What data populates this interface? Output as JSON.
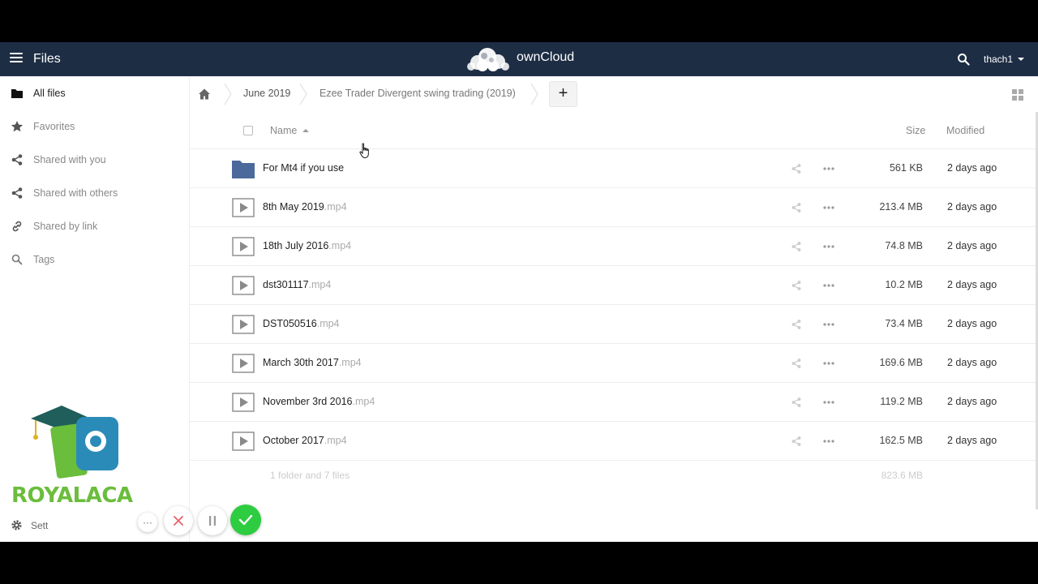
{
  "header": {
    "app_title": "Files",
    "logo_text": "ownCloud",
    "user": "thach1"
  },
  "sidebar": {
    "items": [
      {
        "label": "All files",
        "icon": "folder-icon",
        "active": true
      },
      {
        "label": "Favorites",
        "icon": "star-icon"
      },
      {
        "label": "Shared with you",
        "icon": "share-icon"
      },
      {
        "label": "Shared with others",
        "icon": "share-icon"
      },
      {
        "label": "Shared by link",
        "icon": "link-icon"
      },
      {
        "label": "Tags",
        "icon": "tag-search-icon"
      }
    ],
    "settings_label": "Sett",
    "watermark_text": "ROYALACA"
  },
  "breadcrumb": {
    "items": [
      "June 2019",
      "Ezee Trader Divergent swing trading (2019)"
    ],
    "new_label": "+"
  },
  "table": {
    "headers": {
      "name": "Name",
      "size": "Size",
      "modified": "Modified"
    },
    "rows": [
      {
        "name": "For Mt4 if you use",
        "ext": "",
        "type": "folder",
        "size": "561 KB",
        "modified": "2 days ago"
      },
      {
        "name": "8th May 2019",
        "ext": ".mp4",
        "type": "video",
        "size": "213.4 MB",
        "modified": "2 days ago"
      },
      {
        "name": "18th July 2016",
        "ext": ".mp4",
        "type": "video",
        "size": "74.8 MB",
        "modified": "2 days ago"
      },
      {
        "name": "dst301117",
        "ext": ".mp4",
        "type": "video",
        "size": "10.2 MB",
        "modified": "2 days ago"
      },
      {
        "name": "DST050516",
        "ext": ".mp4",
        "type": "video",
        "size": "73.4 MB",
        "modified": "2 days ago"
      },
      {
        "name": "March 30th 2017",
        "ext": ".mp4",
        "type": "video",
        "size": "169.6 MB",
        "modified": "2 days ago"
      },
      {
        "name": "November 3rd 2016",
        "ext": ".mp4",
        "type": "video",
        "size": "119.2 MB",
        "modified": "2 days ago"
      },
      {
        "name": "October 2017",
        "ext": ".mp4",
        "type": "video",
        "size": "162.5 MB",
        "modified": "2 days ago"
      }
    ],
    "summary": {
      "count": "1 folder and 7 files",
      "total": "823.6 MB"
    }
  },
  "controls": {
    "more_label": "···"
  },
  "colors": {
    "header_bg": "#1d2d44",
    "folder": "#4b6a9b",
    "ok": "#2ecc40",
    "cancel": "#e8606a"
  }
}
